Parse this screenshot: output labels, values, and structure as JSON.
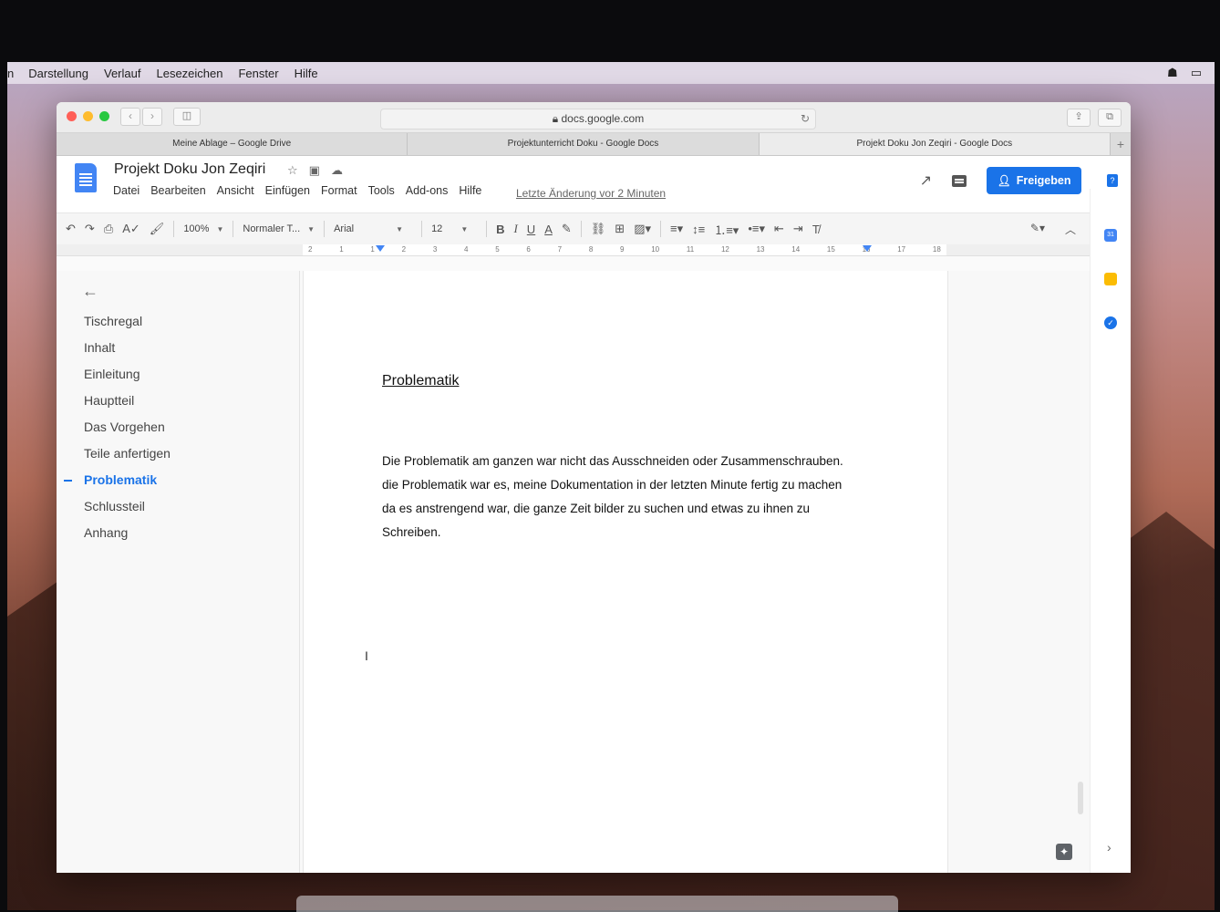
{
  "menubar": {
    "items": [
      "n",
      "Darstellung",
      "Verlauf",
      "Lesezeichen",
      "Fenster",
      "Hilfe"
    ]
  },
  "browser": {
    "url": "docs.google.com",
    "tabs": [
      {
        "label": "Meine Ablage – Google Drive"
      },
      {
        "label": "Projektunterricht Doku - Google Docs"
      },
      {
        "label": "Projekt Doku Jon Zeqiri - Google Docs"
      }
    ]
  },
  "docs": {
    "title": "Projekt Doku Jon Zeqiri",
    "menu": [
      "Datei",
      "Bearbeiten",
      "Ansicht",
      "Einfügen",
      "Format",
      "Tools",
      "Add-ons",
      "Hilfe"
    ],
    "last_edit": "Letzte Änderung vor 2 Minuten",
    "share_label": "Freigeben"
  },
  "toolbar": {
    "zoom": "100%",
    "style": "Normaler T...",
    "font": "Arial",
    "size": "12"
  },
  "ruler": [
    "2",
    "1",
    "1",
    "2",
    "3",
    "4",
    "5",
    "6",
    "7",
    "8",
    "9",
    "10",
    "11",
    "12",
    "13",
    "14",
    "15",
    "16",
    "17",
    "18"
  ],
  "outline": {
    "items": [
      {
        "label": "Tischregal"
      },
      {
        "label": "Inhalt"
      },
      {
        "label": "Einleitung"
      },
      {
        "label": "Hauptteil"
      },
      {
        "label": "Das Vorgehen"
      },
      {
        "label": "Teile anfertigen"
      },
      {
        "label": "Problematik"
      },
      {
        "label": "Schlussteil"
      },
      {
        "label": "Anhang"
      }
    ],
    "active": "Problematik"
  },
  "page": {
    "heading": "Problematik",
    "paragraph": [
      "Die Problematik am ganzen war nicht das Ausschneiden oder Zusammenschrauben.",
      "die Problematik war es, meine Dokumentation in der letzten Minute fertig zu machen",
      "da es anstrengend war, die ganze Zeit bilder zu suchen und etwas zu ihnen zu",
      "Schreiben."
    ]
  },
  "colors": {
    "accent": "#1a73e8",
    "docs_blue": "#4285f4"
  }
}
